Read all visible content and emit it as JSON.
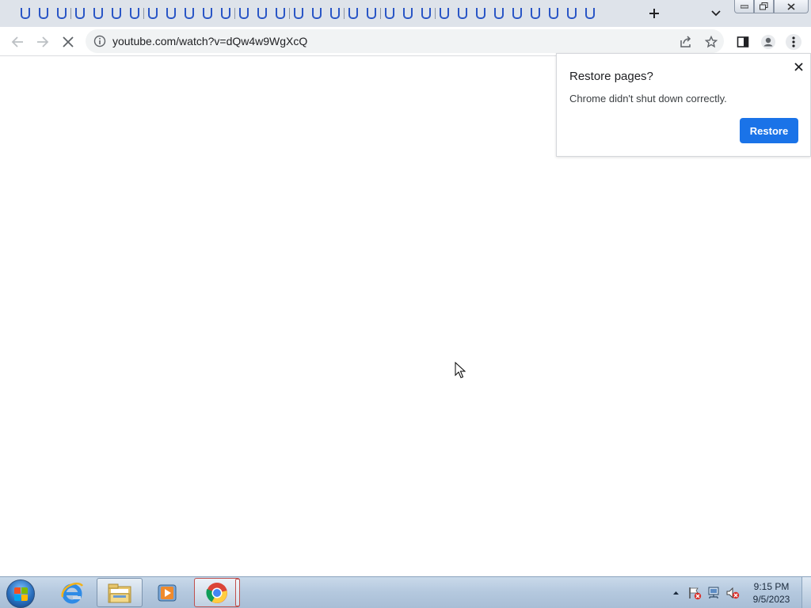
{
  "browser": {
    "tabs_count": 32,
    "new_tab_icon": "plus-icon",
    "tab_search_icon": "chevron-down-icon",
    "window_controls": [
      "minimize-icon",
      "restore-icon",
      "close-icon"
    ]
  },
  "toolbar": {
    "url": "youtube.com/watch?v=dQw4w9WgXcQ",
    "security_icon": "info-icon",
    "buttons": [
      "back-icon",
      "forward-icon",
      "stop-icon",
      "share-icon",
      "bookmark-star-icon",
      "side-panel-icon",
      "profile-icon",
      "menu-icon"
    ]
  },
  "restore_bubble": {
    "title": "Restore pages?",
    "message": "Chrome didn't shut down correctly.",
    "button_label": "Restore",
    "accent": "#1a73e8"
  },
  "taskbar": {
    "apps": [
      "internet-explorer-icon",
      "file-explorer-icon",
      "media-player-icon",
      "chrome-icon"
    ],
    "tray_icons": [
      "show-hidden-icons",
      "action-center-flag-icon",
      "network-icon",
      "volume-muted-icon"
    ],
    "clock": {
      "time": "9:15 PM",
      "date": "9/5/2023"
    }
  }
}
